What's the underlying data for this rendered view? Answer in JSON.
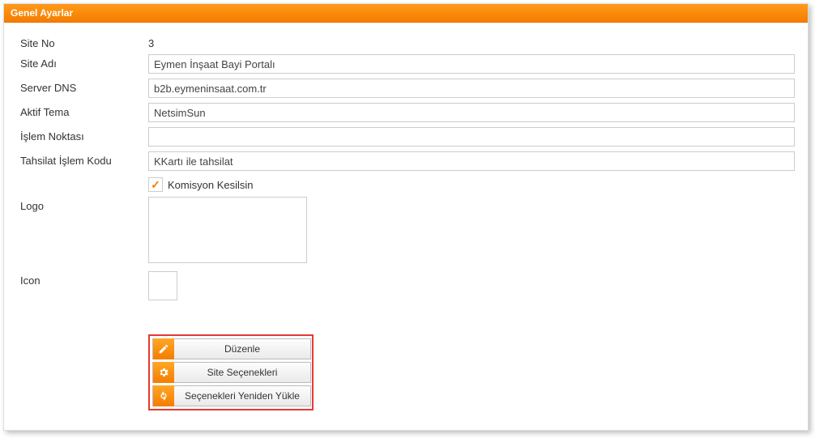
{
  "header": {
    "title": "Genel Ayarlar"
  },
  "fields": {
    "site_no_label": "Site No",
    "site_no_value": "3",
    "site_adi_label": "Site Adı",
    "site_adi_value": "Eymen İnşaat Bayi Portalı",
    "server_dns_label": "Server DNS",
    "server_dns_value": "b2b.eymeninsaat.com.tr",
    "aktif_tema_label": "Aktif Tema",
    "aktif_tema_value": "NetsimSun",
    "islem_noktasi_label": "İşlem Noktası",
    "islem_noktasi_value": "",
    "tahsilat_kodu_label": "Tahsilat İşlem Kodu",
    "tahsilat_kodu_value": "KKartı ile tahsilat",
    "komisyon_label": "Komisyon Kesilsin",
    "komisyon_checked": true,
    "logo_label": "Logo",
    "icon_label": "Icon"
  },
  "buttons": {
    "duzenle": "Düzenle",
    "site_secenekleri": "Site Seçenekleri",
    "yeniden_yukle": "Seçenekleri Yeniden Yükle"
  }
}
